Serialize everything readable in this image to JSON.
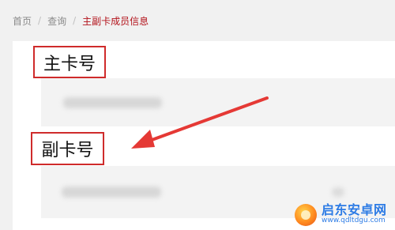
{
  "breadcrumb": {
    "items": [
      "首页",
      "查询",
      "主副卡成员信息"
    ],
    "separators": [
      "/",
      "/"
    ]
  },
  "sections": {
    "main_label": "主卡号",
    "sub_label": "副卡号"
  },
  "watermark": {
    "title": "启东安卓网",
    "url": "www.qdltdgu.com"
  },
  "colors": {
    "highlight_red": "#cf2b2b",
    "arrow_red": "#e53935",
    "breadcrumb_active": "#b3131b"
  },
  "icons": {
    "arrow": "red-pointer-arrow-icon",
    "logo": "watermark-logo-icon"
  }
}
